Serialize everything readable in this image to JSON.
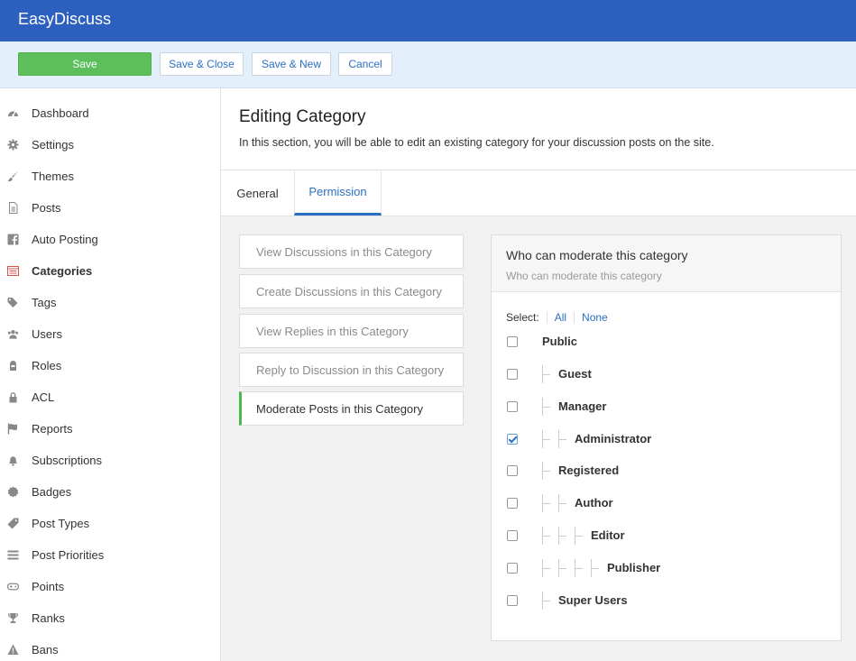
{
  "app": {
    "title": "EasyDiscuss"
  },
  "toolbar": {
    "save_label": "Save",
    "save_close_label": "Save & Close",
    "save_new_label": "Save & New",
    "cancel_label": "Cancel"
  },
  "sidebar": {
    "items": [
      {
        "label": "Dashboard",
        "icon": "dashboard-icon"
      },
      {
        "label": "Settings",
        "icon": "gear-icon"
      },
      {
        "label": "Themes",
        "icon": "brush-icon"
      },
      {
        "label": "Posts",
        "icon": "document-icon"
      },
      {
        "label": "Auto Posting",
        "icon": "facebook-icon"
      },
      {
        "label": "Categories",
        "icon": "categories-icon",
        "active": true
      },
      {
        "label": "Tags",
        "icon": "tags-icon"
      },
      {
        "label": "Users",
        "icon": "users-icon"
      },
      {
        "label": "Roles",
        "icon": "roles-icon"
      },
      {
        "label": "ACL",
        "icon": "lock-icon"
      },
      {
        "label": "Reports",
        "icon": "flag-icon"
      },
      {
        "label": "Subscriptions",
        "icon": "bell-icon"
      },
      {
        "label": "Badges",
        "icon": "badge-icon"
      },
      {
        "label": "Post Types",
        "icon": "tag-icon"
      },
      {
        "label": "Post Priorities",
        "icon": "list-icon"
      },
      {
        "label": "Points",
        "icon": "gamepad-icon"
      },
      {
        "label": "Ranks",
        "icon": "trophy-icon"
      },
      {
        "label": "Bans",
        "icon": "warning-icon"
      }
    ]
  },
  "header": {
    "title": "Editing Category",
    "description": "In this section, you will be able to edit an existing category for your discussion posts on the site."
  },
  "tabs": [
    {
      "label": "General"
    },
    {
      "label": "Permission",
      "active": true
    }
  ],
  "permissions": [
    {
      "label": "View Discussions in this Category"
    },
    {
      "label": "Create Discussions in this Category"
    },
    {
      "label": "View Replies in this Category"
    },
    {
      "label": "Reply to Discussion in this Category"
    },
    {
      "label": "Moderate Posts in this Category",
      "active": true
    }
  ],
  "panel": {
    "title": "Who can moderate this category",
    "subtitle": "Who can moderate this category",
    "select_label": "Select:",
    "all_label": "All",
    "none_label": "None",
    "groups": [
      {
        "name": "Public",
        "depth": 0,
        "checked": false
      },
      {
        "name": "Guest",
        "depth": 1,
        "checked": false
      },
      {
        "name": "Manager",
        "depth": 1,
        "checked": false
      },
      {
        "name": "Administrator",
        "depth": 2,
        "checked": true
      },
      {
        "name": "Registered",
        "depth": 1,
        "checked": false
      },
      {
        "name": "Author",
        "depth": 2,
        "checked": false
      },
      {
        "name": "Editor",
        "depth": 3,
        "checked": false
      },
      {
        "name": "Publisher",
        "depth": 4,
        "checked": false
      },
      {
        "name": "Super Users",
        "depth": 1,
        "checked": false
      }
    ]
  },
  "colors": {
    "topbar": "#2d5fbf",
    "save": "#5cbf5c",
    "link": "#2a6fc2",
    "active_border": "#4cb94c"
  }
}
